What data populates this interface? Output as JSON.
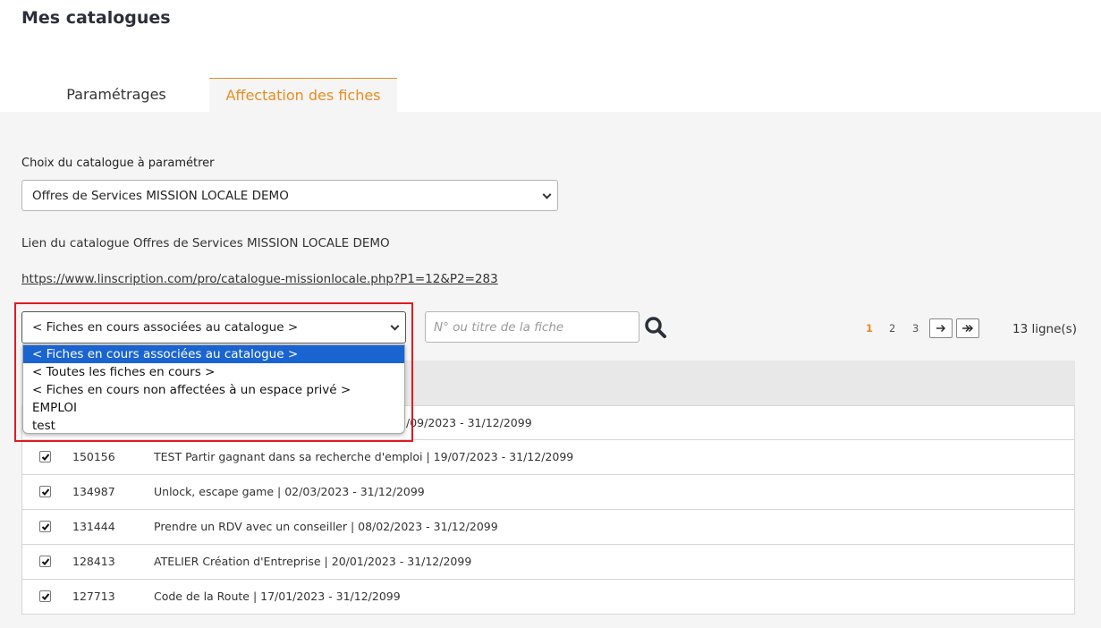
{
  "page": {
    "title": "Mes catalogues"
  },
  "tabs": [
    {
      "label": "Paramétrages",
      "active": false
    },
    {
      "label": "Affectation des fiches",
      "active": true
    }
  ],
  "catalog": {
    "choice_label": "Choix du catalogue à paramétrer",
    "selected": "Offres de Services MISSION LOCALE DEMO",
    "link_label": "Lien du catalogue Offres de Services MISSION LOCALE DEMO",
    "url": "https://www.linscription.com/pro/catalogue-missionlocale.php?P1=12&P2=283"
  },
  "filter": {
    "selected": "< Fiches en cours associées au catalogue >",
    "options": [
      "< Fiches en cours associées au catalogue >",
      "< Toutes les fiches en cours >",
      "< Fiches en cours non affectées à un espace privé >",
      "EMPLOI",
      "test"
    ]
  },
  "search": {
    "placeholder": "N° ou titre de la fiche",
    "icon": "search-icon"
  },
  "pagination": {
    "pages": [
      "1",
      "2",
      "3"
    ],
    "current": "1",
    "next_icon": "arrow-right-icon",
    "last_icon": "arrow-last-icon"
  },
  "row_count": "13 ligne(s)",
  "rows": [
    {
      "id": "",
      "title": "/09/2023 - 31/12/2099",
      "checked": true
    },
    {
      "id": "150156",
      "title": "TEST Partir gagnant dans sa recherche d'emploi | 19/07/2023 - 31/12/2099",
      "checked": true
    },
    {
      "id": "134987",
      "title": "Unlock, escape game | 02/03/2023 - 31/12/2099",
      "checked": true
    },
    {
      "id": "131444",
      "title": "Prendre un RDV avec un conseiller | 08/02/2023 - 31/12/2099",
      "checked": true
    },
    {
      "id": "128413",
      "title": "ATELIER Création d'Entreprise | 20/01/2023 - 31/12/2099",
      "checked": true
    },
    {
      "id": "127713",
      "title": "Code de la Route | 17/01/2023 - 31/12/2099",
      "checked": true
    }
  ],
  "colors": {
    "accent": "#ee8b1f",
    "highlight": "#e01b22",
    "selected_option": "#1a64d2"
  }
}
